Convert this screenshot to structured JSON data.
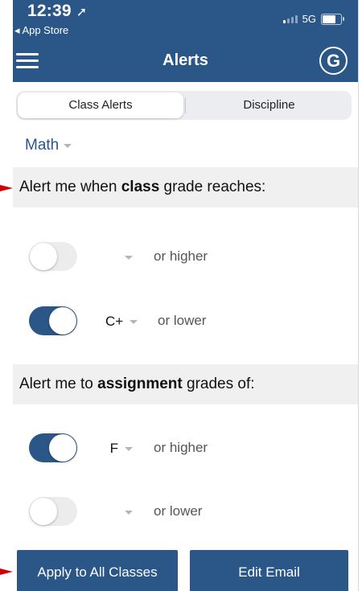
{
  "status_bar": {
    "time": "12:39",
    "back_label": "App Store",
    "network": "5G"
  },
  "header": {
    "title": "Alerts",
    "avatar_letter": "G"
  },
  "segments": {
    "active": "Class Alerts",
    "inactive": "Discipline"
  },
  "class_picker": {
    "value": "Math"
  },
  "class_section": {
    "prefix": "Alert me when ",
    "bold": "class",
    "suffix": " grade reaches:",
    "rows": [
      {
        "enabled": false,
        "grade": "",
        "threshold": "or higher"
      },
      {
        "enabled": true,
        "grade": "C+",
        "threshold": "or lower"
      }
    ]
  },
  "assignment_section": {
    "prefix": "Alert me to ",
    "bold": "assignment",
    "suffix": " grades of:",
    "rows": [
      {
        "enabled": true,
        "grade": "F",
        "threshold": "or higher"
      },
      {
        "enabled": false,
        "grade": "",
        "threshold": "or lower"
      }
    ]
  },
  "buttons": {
    "apply": "Apply to All Classes",
    "edit_email": "Edit Email"
  },
  "colors": {
    "primary": "#2a5787",
    "annotation": "#d40000"
  }
}
